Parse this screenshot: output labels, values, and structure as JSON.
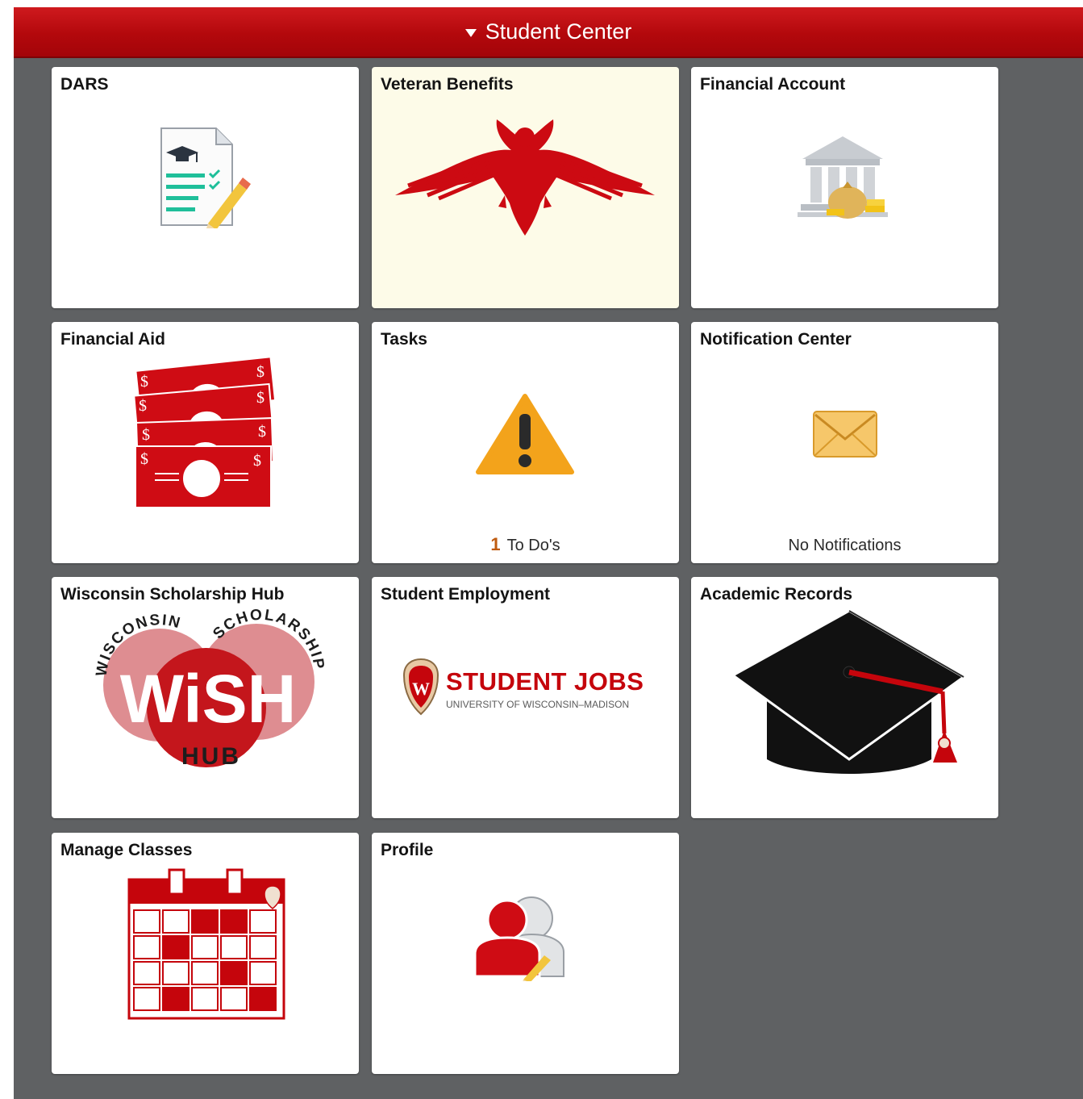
{
  "header": {
    "title": "Student Center"
  },
  "colors": {
    "brand_red": "#c5050c",
    "header_bg": "#b3080c",
    "page_bg": "#5f6163",
    "highlight_tile": "#fdfbe8"
  },
  "tiles": [
    {
      "title": "DARS",
      "icon": "degree-audit-document-icon"
    },
    {
      "title": "Veteran Benefits",
      "icon": "eagle-icon"
    },
    {
      "title": "Financial Account",
      "icon": "bank-building-coins-icon"
    },
    {
      "title": "Financial Aid",
      "icon": "money-bills-icon"
    },
    {
      "title": "Tasks",
      "icon": "warning-icon",
      "count": "1",
      "count_label": "To Do's"
    },
    {
      "title": "Notification Center",
      "icon": "envelope-icon",
      "status": "No Notifications"
    },
    {
      "title": "Wisconsin Scholarship Hub",
      "icon": "wish-logo",
      "logo_text": {
        "top_left": "WISCONSIN",
        "top_right": "SCHOLARSHIP",
        "center": "WiSH",
        "bottom": "HUB"
      }
    },
    {
      "title": "Student Employment",
      "icon": "student-jobs-logo",
      "logo_text": {
        "main": "STUDENT JOBS",
        "sub": "UNIVERSITY OF WISCONSIN–MADISON"
      }
    },
    {
      "title": "Academic Records",
      "icon": "graduation-cap-icon"
    },
    {
      "title": "Manage Classes",
      "icon": "calendar-icon"
    },
    {
      "title": "Profile",
      "icon": "profile-people-icon"
    }
  ]
}
